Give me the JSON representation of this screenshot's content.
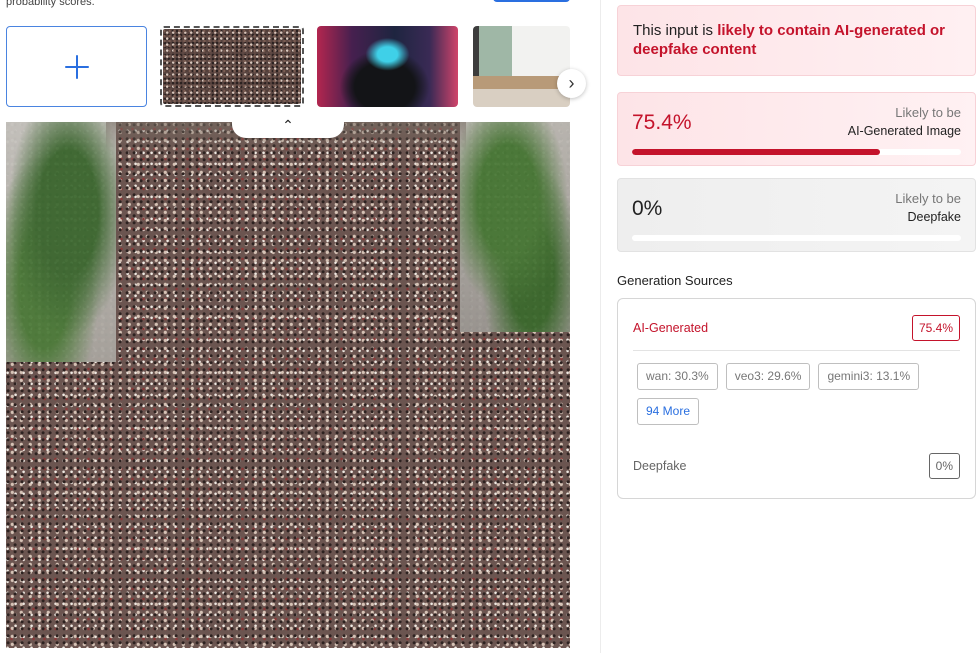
{
  "left": {
    "intro_text": "probability scores.",
    "thumbnails": [
      {
        "label": "add-upload"
      },
      {
        "label": "crowd-aerial",
        "selected": true
      },
      {
        "label": "cyberpunk-woman"
      },
      {
        "label": "modern-living-room"
      }
    ],
    "next_icon": "›",
    "collapse_icon": "⌃"
  },
  "verdict": {
    "prefix": "This input is ",
    "highlight": "likely to contain AI-generated or deepfake content"
  },
  "scores": {
    "ai": {
      "value": "75.4%",
      "label_top": "Likely to be",
      "label_main": "AI-Generated Image",
      "fraction": 0.754
    },
    "deepfake": {
      "value": "0%",
      "label_top": "Likely to be",
      "label_main": "Deepfake",
      "fraction": 0
    }
  },
  "sources": {
    "heading": "Generation Sources",
    "ai_title": "AI-Generated",
    "ai_value": "75.4%",
    "chips": [
      "wan: 30.3%",
      "veo3: 29.6%",
      "gemini3: 13.1%"
    ],
    "more_label": "94 More",
    "deepfake_title": "Deepfake",
    "deepfake_value": "0%"
  },
  "colors": {
    "accent_red": "#c4132b",
    "accent_blue": "#2a6fe0"
  }
}
